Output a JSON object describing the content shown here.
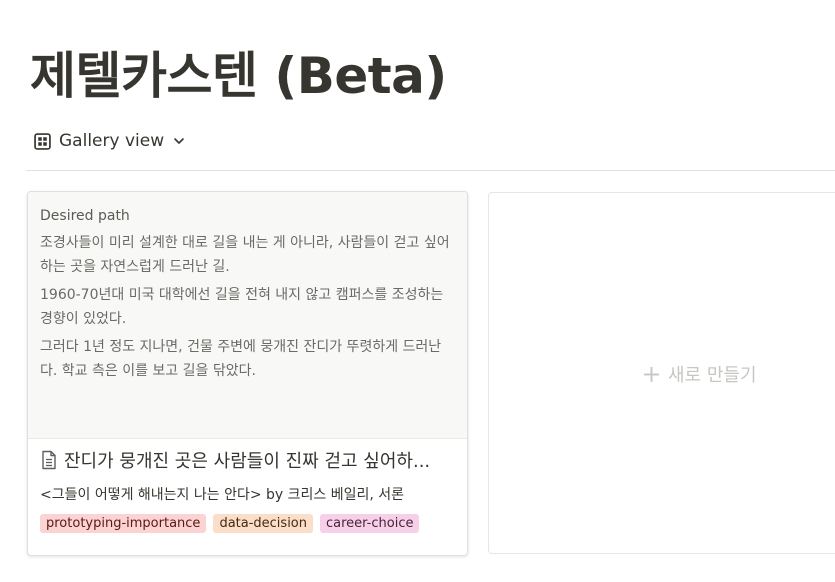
{
  "page": {
    "title": "제텔카스텐 (Beta)"
  },
  "view": {
    "label": "Gallery view",
    "icon": "gallery-grid-icon",
    "dropdown_icon": "chevron-down-icon"
  },
  "cards": [
    {
      "preview": {
        "heading": "Desired path",
        "paragraphs": [
          "조경사들이 미리 설계한 대로 길을 내는 게 아니라, 사람들이 걷고 싶어하는 곳을 자연스럽게 드러난 길.",
          "1960-70년대 미국 대학에선 길을 전혀 내지 않고 캠퍼스를 조성하는 경향이 있었다.",
          "그러다 1년 정도 지나면, 건물 주변에 뭉개진 잔디가 뚜렷하게 드러난다. 학교 측은 이를 보고 길을 닦았다."
        ]
      },
      "title": "잔디가 뭉개진 곳은 사람들이 진짜 걷고 싶어하...",
      "title_icon": "document-icon",
      "source": "<그들이 어떻게 해내는지 나는 안다> by 크리스 베일리, 서론",
      "tags": [
        {
          "label": "prototyping-importance",
          "color": "#fbd3d3"
        },
        {
          "label": "data-decision",
          "color": "#fadec9"
        },
        {
          "label": "career-choice",
          "color": "#f5d0e8"
        }
      ]
    }
  ],
  "new_card": {
    "label": "새로 만들기",
    "icon": "plus-icon"
  },
  "colors": {
    "text": "#37352f",
    "muted_text": "#6b6a66",
    "placeholder": "#c7c6c3",
    "preview_bg": "#f8f8f7"
  }
}
